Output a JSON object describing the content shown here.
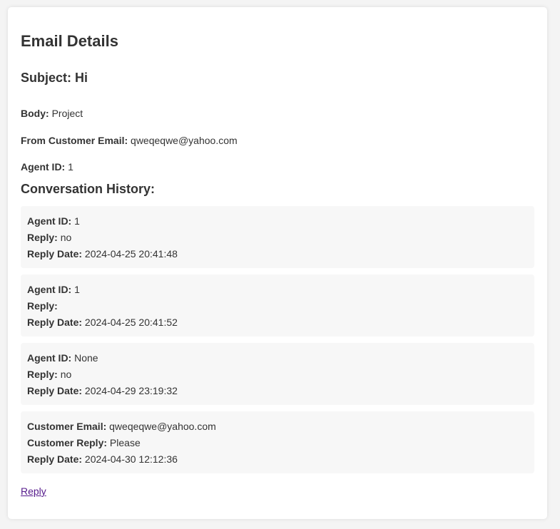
{
  "page": {
    "title": "Email Details"
  },
  "email": {
    "subject_label": "Subject:",
    "subject": "Hi",
    "body_label": "Body:",
    "body": "Project",
    "from_label": "From Customer Email:",
    "from": "qweqeqwe@yahoo.com",
    "agent_label": "Agent ID:",
    "agent_id": "1"
  },
  "history": {
    "title": "Conversation History:",
    "messages": [
      {
        "l1_label": "Agent ID:",
        "l1_value": "1",
        "l2_label": "Reply:",
        "l2_value": "no",
        "l3_label": "Reply Date:",
        "l3_value": "2024-04-25 20:41:48"
      },
      {
        "l1_label": "Agent ID:",
        "l1_value": "1",
        "l2_label": "Reply:",
        "l2_value": "",
        "l3_label": "Reply Date:",
        "l3_value": "2024-04-25 20:41:52"
      },
      {
        "l1_label": "Agent ID:",
        "l1_value": "None",
        "l2_label": "Reply:",
        "l2_value": "no",
        "l3_label": "Reply Date:",
        "l3_value": "2024-04-29 23:19:32"
      },
      {
        "l1_label": "Customer Email:",
        "l1_value": "qweqeqwe@yahoo.com",
        "l2_label": "Customer Reply:",
        "l2_value": "Please",
        "l3_label": "Reply Date:",
        "l3_value": "2024-04-30 12:12:36"
      }
    ]
  },
  "actions": {
    "reply_label": "Reply"
  },
  "colors": {
    "background": "#f4f4f4",
    "card": "#ffffff",
    "message_bg": "#f7f7f7",
    "text": "#333333",
    "link_visited": "#551a8b"
  }
}
